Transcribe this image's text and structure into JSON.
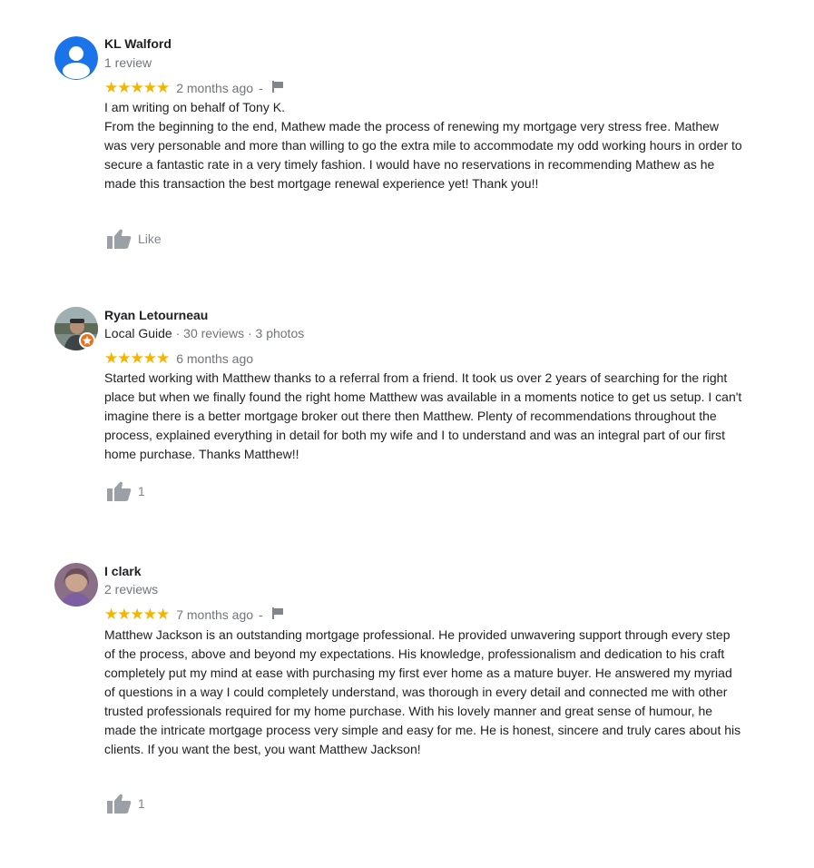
{
  "reviews": [
    {
      "name": "KL Walford",
      "reviewer_info": "1 review",
      "stars": "★★★★★",
      "date": "2 months ago",
      "separator": "-",
      "body_lines": [
        "I am writing on behalf of Tony K.",
        "From the beginning to the end, Mathew made the process of renewing my mortgage very stress free. Mathew was very personable and more than willing to go the extra mile to accommodate my odd working hours in order to secure a fantastic rate in a very timely fashion.  I would have no reservations in recommending Mathew as he made this transaction the best mortgage renewal experience yet!  Thank you!!"
      ],
      "like_label": "Like",
      "avatar_color": "#1a73e8",
      "rating": 5
    },
    {
      "name": "Ryan Letourneau",
      "local_guide": "Local Guide",
      "reviewer_info": " · 30 reviews · 3 photos",
      "stars": "★★★★★",
      "date": "6 months ago",
      "body_lines": [
        "Started working with Matthew thanks to a referral from a friend. It took us over 2 years of searching for the right place but when we finally found the right home Matthew was available in a moments notice to get us setup. I can't imagine there is a better mortgage broker out there then Matthew. Plenty of recommendations throughout the process, explained everything in detail for both my wife and I to understand and was an integral part of our first home purchase. Thanks Matthew!!"
      ],
      "like_label": "1",
      "rating": 5
    },
    {
      "name": "I clark",
      "reviewer_info": "2 reviews",
      "stars": "★★★★★",
      "date": "7 months ago",
      "separator": "-",
      "body_lines": [
        "Matthew Jackson is an outstanding mortgage professional. He provided unwavering support through every step of the process, above and beyond my expectations. His knowledge, professionalism and dedication to his craft completely put my mind at ease with purchasing my first ever home as a mature buyer. He answered my myriad of questions in a way I could completely understand, was thorough in every detail and connected me with other trusted professionals required for my home purchase. With his lovely manner and great sense of humour, he made the intricate mortgage process very simple and easy for me. He is honest, sincere and truly cares about his clients. If you want the best, you want Matthew Jackson!"
      ],
      "like_label": "1",
      "rating": 5
    }
  ],
  "colors": {
    "star": "#f4b400",
    "muted": "#70757a",
    "text": "#202124",
    "local_guide_badge": "#e8711c"
  },
  "icons": [
    "default-avatar-icon",
    "flag-icon",
    "thumbs-up-icon",
    "local-guide-badge-icon"
  ]
}
